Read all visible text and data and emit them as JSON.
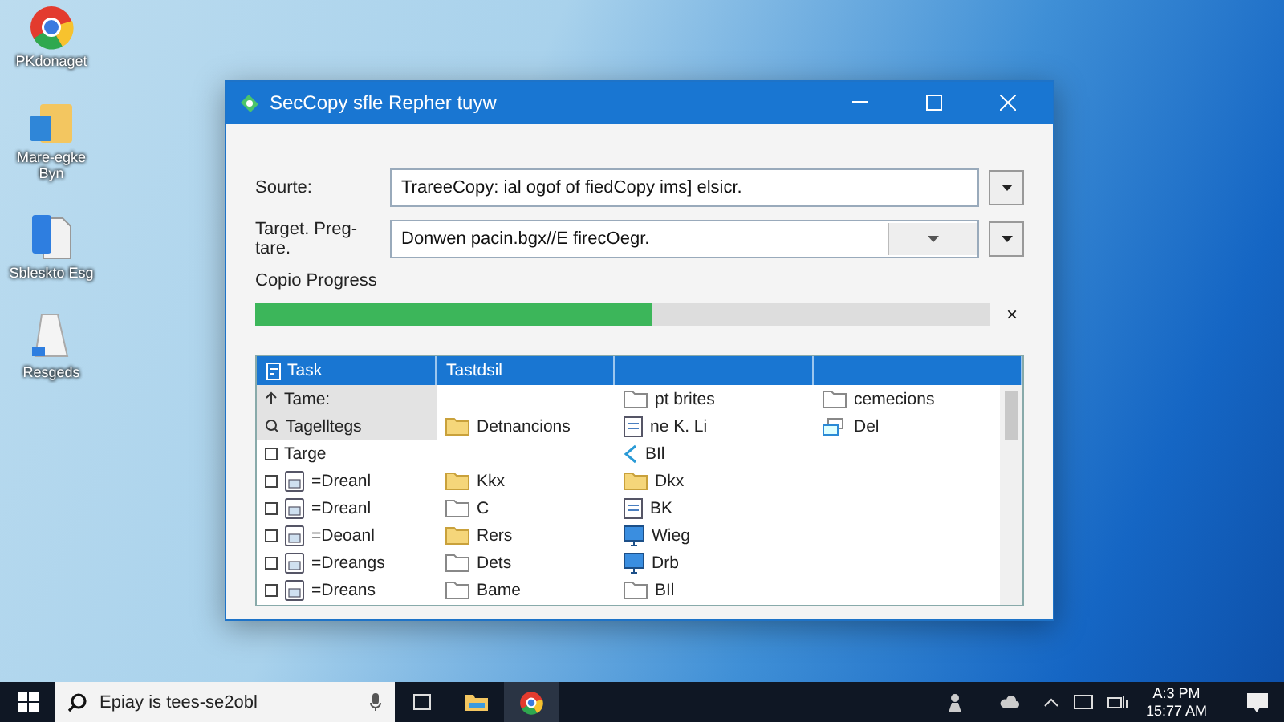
{
  "desktop_icons": [
    {
      "kind": "browser",
      "label": "PKdonaget"
    },
    {
      "kind": "folder",
      "label": "Mare-egke Byn"
    },
    {
      "kind": "document",
      "label": "Sbleskto Esg"
    },
    {
      "kind": "bin",
      "label": "Resgeds"
    }
  ],
  "window": {
    "title": "SecCopy sfle Repher tuyw"
  },
  "source": {
    "label": "Sourte:",
    "value": "TrareeCopy: ial ogof of fiedCopy ims] elsicr."
  },
  "target": {
    "label": "Target. Preg-tare.",
    "value": "Donwen pacin.bgx//E firecOegr."
  },
  "progress": {
    "label": "Copio Progress",
    "level": 0.54,
    "close": "×"
  },
  "table": {
    "columns": [
      "Task",
      "Tastdsil",
      "",
      ""
    ],
    "rows": [
      {
        "selected": true,
        "cells": [
          {
            "kind": "up",
            "text": "Tame:"
          },
          {},
          {
            "kind": "outline",
            "text": "pt brites"
          },
          {
            "kind": "outline",
            "text": "cemecions"
          }
        ]
      },
      {
        "selected": true,
        "cells": [
          {
            "kind": "search",
            "text": "Tagelltegs"
          },
          {
            "kind": "folder",
            "text": "Detnancions"
          },
          {
            "kind": "doc",
            "text": "ne K. Li"
          },
          {
            "kind": "share",
            "text": "Del"
          }
        ]
      },
      {
        "selected": false,
        "cells": [
          {
            "kind": "box",
            "text": "Targe"
          },
          {},
          {
            "kind": "arrow",
            "text": "BIl"
          },
          {}
        ]
      },
      {
        "selected": false,
        "cells": [
          {
            "kind": "form",
            "text": "=Dreanl"
          },
          {
            "kind": "folder",
            "text": "Kkx"
          },
          {
            "kind": "folder",
            "text": "Dkx"
          },
          {}
        ]
      },
      {
        "selected": false,
        "cells": [
          {
            "kind": "form",
            "text": "=Dreanl"
          },
          {
            "kind": "outline",
            "text": "C"
          },
          {
            "kind": "doc",
            "text": "BK"
          },
          {}
        ]
      },
      {
        "selected": false,
        "cells": [
          {
            "kind": "form",
            "text": "=Deoanl"
          },
          {
            "kind": "folder",
            "text": "Rers"
          },
          {
            "kind": "monitor",
            "text": "Wieg"
          },
          {}
        ]
      },
      {
        "selected": false,
        "cells": [
          {
            "kind": "form",
            "text": "=Dreangs"
          },
          {
            "kind": "outline",
            "text": "Dets"
          },
          {
            "kind": "monitor",
            "text": "Drb"
          },
          {}
        ]
      },
      {
        "selected": false,
        "cells": [
          {
            "kind": "form",
            "text": "=Dreans"
          },
          {
            "kind": "outline",
            "text": "Bame"
          },
          {
            "kind": "outline",
            "text": "BIl"
          },
          {}
        ]
      }
    ]
  },
  "taskbar": {
    "search_placeholder": "Epiay is tees-se2obl",
    "time": "A:3 PM",
    "date": "15:77 AM"
  }
}
